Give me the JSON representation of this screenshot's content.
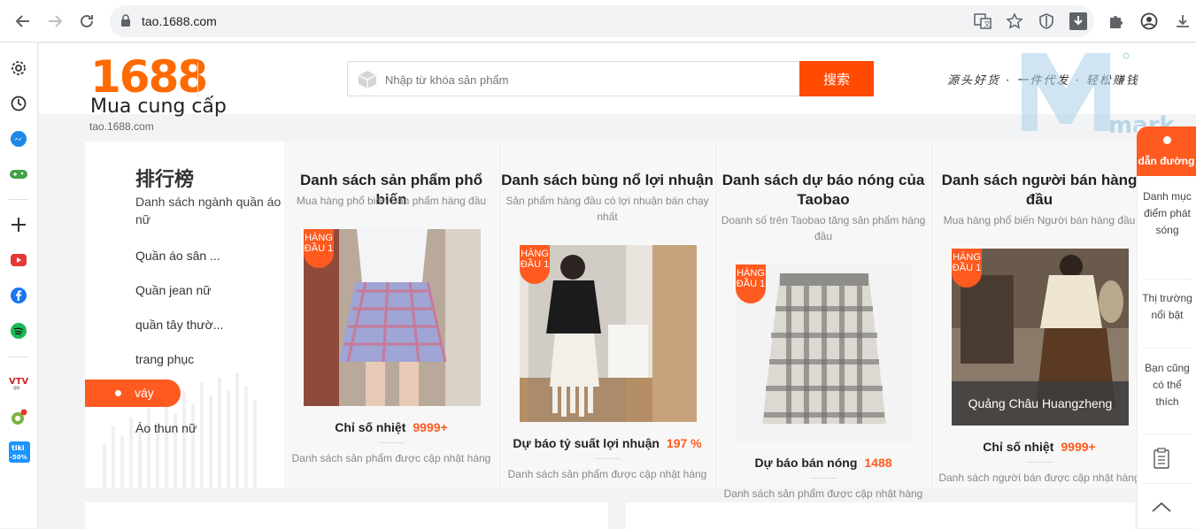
{
  "browser": {
    "url": "tao.1688.com",
    "icons": [
      "back-arrow-icon",
      "forward-arrow-icon",
      "reload-icon",
      "lock-icon",
      "translate-icon",
      "star-icon",
      "shield-icon",
      "download-box-icon",
      "puzzle-icon",
      "profile-icon",
      "download-icon"
    ]
  },
  "sidebar": {
    "icons": [
      "gear-icon",
      "history-icon",
      "messenger-icon",
      "gamepad-icon",
      "plus-icon",
      "youtube-icon",
      "facebook-icon",
      "spotify-icon",
      "vtv-icon",
      "extension-icon",
      "tiki-icon"
    ]
  },
  "header": {
    "logo_number": "1688",
    "logo_sub": "Mua cung cấp",
    "site_url": "tao.1688.com",
    "search_placeholder": "Nhập từ khóa sản phẩm",
    "search_button": "搜索",
    "slogan": "源头好货 · 一件代发 · 轻松赚钱",
    "watermark": "mark"
  },
  "categories": {
    "title": "排行榜",
    "subtitle": "Danh sách ngành quần áo nữ",
    "items": [
      "Quần áo sân ...",
      "Quần jean nữ",
      "quần tây thườ...",
      "trang phục",
      "váy",
      "Áo thun nữ"
    ],
    "active": "váy"
  },
  "columns": [
    {
      "title": "Danh sách sản phẩm phổ biến",
      "subtitle": "Mua hàng phổ biến Sản phẩm hàng đầu",
      "tag": "HÀNG ĐẦU 1",
      "metric_label": "Chỉ số nhiệt",
      "metric_value": "9999+",
      "footer": "Danh sách sản phẩm được cập nhật hàng"
    },
    {
      "title": "Danh sách bùng nổ lợi nhuận",
      "subtitle": "Sản phẩm hàng đầu có lợi nhuận bán chạy nhất",
      "tag": "HÀNG ĐẦU 1",
      "metric_label": "Dự báo tỷ suất lợi nhuận",
      "metric_value": "197 %",
      "footer": "Danh sách sản phẩm được cập nhật hàng"
    },
    {
      "title": "Danh sách dự báo nóng của Taobao",
      "subtitle": "Doanh số trên Taobao tăng sản phẩm hàng đầu",
      "tag": "HÀNG ĐẦU 1",
      "metric_label": "Dự báo bán nóng",
      "metric_value": "1488",
      "footer": "Danh sách sản phẩm được cập nhật hàng"
    },
    {
      "title": "Danh sách người bán hàng đầu",
      "subtitle": "Mua hàng phổ biến Người bán hàng đầu",
      "tag": "HÀNG ĐẦU 1",
      "seller_name": "Quảng Châu Huangzheng",
      "metric_label": "Chỉ số nhiệt",
      "metric_value": "9999+",
      "footer": "Danh sách người bán được cập nhật hàng"
    }
  ],
  "right_float": {
    "top": "dẫn đường",
    "items": [
      "Danh mục điểm phát sóng",
      "Thị trường nổi bật",
      "Bạn cũng có thể thích"
    ],
    "icons": [
      "clipboard-icon",
      "chevron-up-icon"
    ]
  },
  "colors": {
    "accent": "#ff5a1f",
    "brand": "#ff6a00"
  }
}
